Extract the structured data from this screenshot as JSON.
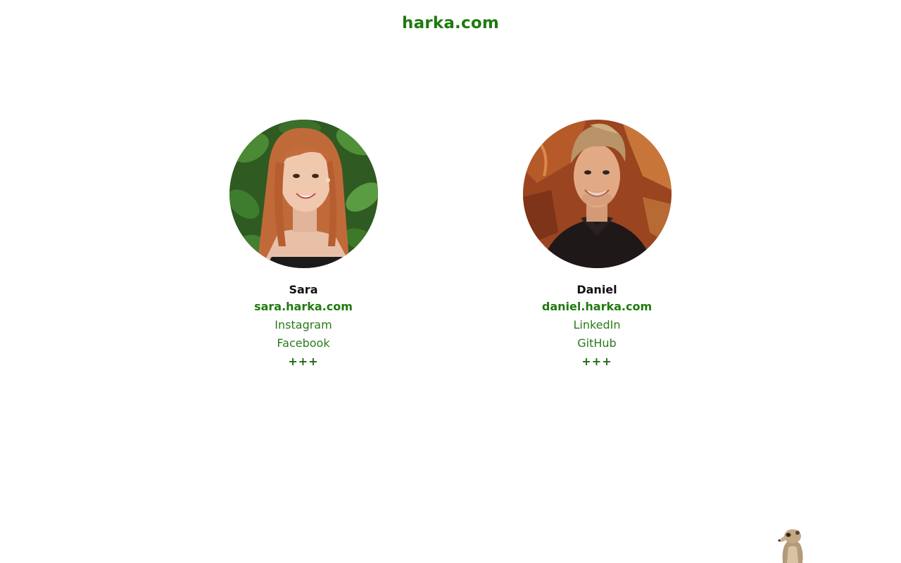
{
  "header": {
    "site_title": "harka.com"
  },
  "people": [
    {
      "name": "Sara",
      "site": "sara.harka.com",
      "links": [
        "Instagram",
        "Facebook"
      ],
      "more": "+++"
    },
    {
      "name": "Daniel",
      "site": "daniel.harka.com",
      "links": [
        "LinkedIn",
        "GitHub"
      ],
      "more": "+++"
    }
  ],
  "colors": {
    "accent_green": "#1f7a0f",
    "text_dark": "#111111",
    "background": "#ffffff"
  },
  "icons": {
    "mascot": "meerkat-image"
  }
}
